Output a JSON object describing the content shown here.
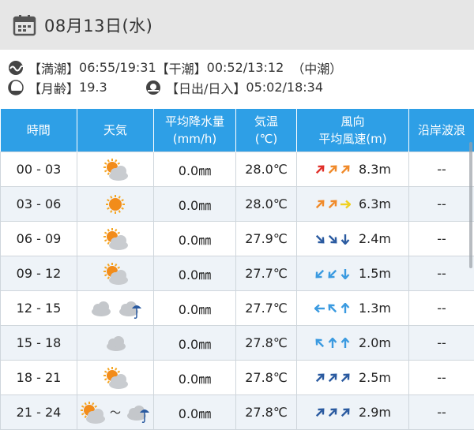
{
  "header": {
    "date": "08月13日(水)",
    "icon": "calendar-icon"
  },
  "tide": {
    "high_label": "【満潮】",
    "high_value": "06:55/19:31",
    "low_label": "【干潮】",
    "low_value": "00:52/13:12",
    "type": "（中潮）"
  },
  "moon": {
    "label": "【月齢】",
    "value": "19.3"
  },
  "sun": {
    "label": "【日出/日入】",
    "value": "05:02/18:34"
  },
  "table": {
    "headers": {
      "time": "時間",
      "weather": "天気",
      "precip_line1": "平均降水量",
      "precip_line2": "(mm/h)",
      "temp_line1": "気温",
      "temp_line2": "(℃)",
      "wind_line1": "風向",
      "wind_line2": "平均風速(m)",
      "wave": "沿岸波浪"
    },
    "rows": [
      {
        "time": "00 - 03",
        "weather": [
          "sun-cloud"
        ],
        "precip": "0.0㎜",
        "temp": "28.0℃",
        "wind_dirs": [
          45,
          45,
          45
        ],
        "wind_colors": [
          "#e0302a",
          "#f08a2a",
          "#f08a2a"
        ],
        "wind_speed": "8.3m",
        "wave": "--"
      },
      {
        "time": "03 - 06",
        "weather": [
          "sun"
        ],
        "precip": "0.0㎜",
        "temp": "28.0℃",
        "wind_dirs": [
          45,
          45,
          90
        ],
        "wind_colors": [
          "#f08a2a",
          "#f08a2a",
          "#f0d020"
        ],
        "wind_speed": "6.3m",
        "wave": "--"
      },
      {
        "time": "06 - 09",
        "weather": [
          "sun-cloud"
        ],
        "precip": "0.0㎜",
        "temp": "27.9℃",
        "wind_dirs": [
          135,
          135,
          180
        ],
        "wind_colors": [
          "#2a5aa0",
          "#2a5aa0",
          "#2a5aa0"
        ],
        "wind_speed": "2.4m",
        "wave": "--"
      },
      {
        "time": "09 - 12",
        "weather": [
          "sun-cloud"
        ],
        "precip": "0.0㎜",
        "temp": "27.7℃",
        "wind_dirs": [
          225,
          225,
          180
        ],
        "wind_colors": [
          "#3a9ae0",
          "#3a9ae0",
          "#3a9ae0"
        ],
        "wind_speed": "1.5m",
        "wave": "--"
      },
      {
        "time": "12 - 15",
        "weather": [
          "cloud",
          "cloud-rain-sun"
        ],
        "precip": "0.0㎜",
        "temp": "27.7℃",
        "wind_dirs": [
          270,
          315,
          0
        ],
        "wind_colors": [
          "#3a9ae0",
          "#3a9ae0",
          "#3a9ae0"
        ],
        "wind_speed": "1.3m",
        "wave": "--"
      },
      {
        "time": "15 - 18",
        "weather": [
          "cloud"
        ],
        "precip": "0.0㎜",
        "temp": "27.8℃",
        "wind_dirs": [
          315,
          0,
          0
        ],
        "wind_colors": [
          "#3a9ae0",
          "#3a9ae0",
          "#3a9ae0"
        ],
        "wind_speed": "2.0m",
        "wave": "--"
      },
      {
        "time": "18 - 21",
        "weather": [
          "sun-cloud"
        ],
        "precip": "0.0㎜",
        "temp": "27.8℃",
        "wind_dirs": [
          45,
          45,
          45
        ],
        "wind_colors": [
          "#2a5aa0",
          "#2a5aa0",
          "#2a5aa0"
        ],
        "wind_speed": "2.5m",
        "wave": "--"
      },
      {
        "time": "21 - 24",
        "weather": [
          "sun-cloud",
          "cloud-rain"
        ],
        "weather_sep": "～",
        "precip": "0.0㎜",
        "temp": "27.8℃",
        "wind_dirs": [
          45,
          45,
          45
        ],
        "wind_colors": [
          "#2a5aa0",
          "#2a5aa0",
          "#2a5aa0"
        ],
        "wind_speed": "2.9m",
        "wave": "--"
      }
    ]
  }
}
